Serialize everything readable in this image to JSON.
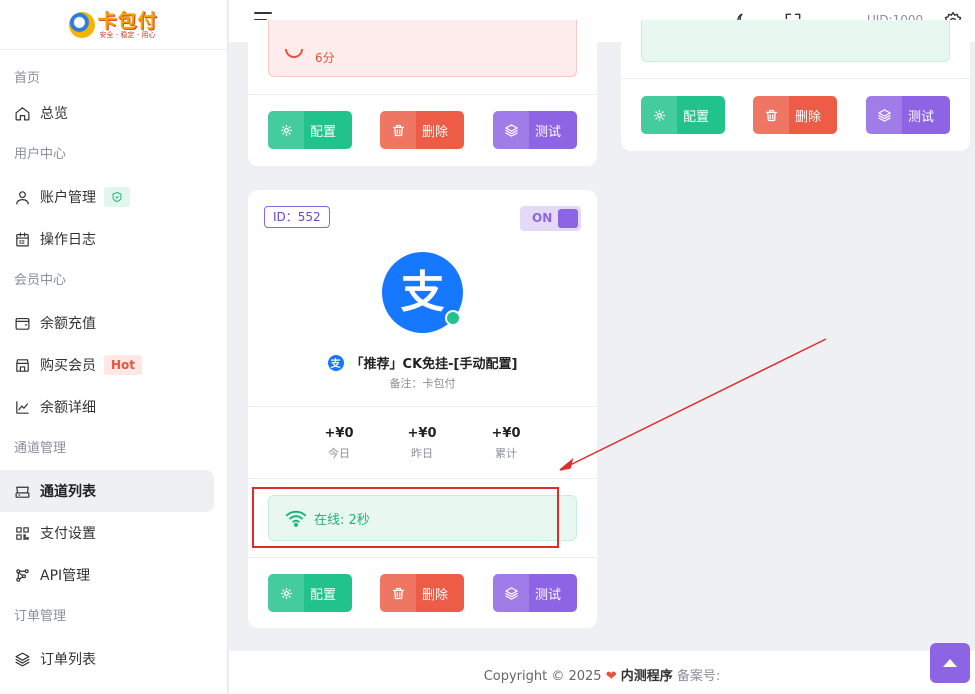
{
  "brand": {
    "logo_title": "卡包付",
    "logo_sub": "安全 - 稳定 - 用心"
  },
  "sidebar": {
    "sections": [
      {
        "title": "首页",
        "items": [
          {
            "label": "总览",
            "icon": "home-icon"
          }
        ]
      },
      {
        "title": "用户中心",
        "items": [
          {
            "label": "账户管理",
            "icon": "user-icon",
            "badge": "shield"
          },
          {
            "label": "操作日志",
            "icon": "calendar-icon"
          }
        ]
      },
      {
        "title": "会员中心",
        "items": [
          {
            "label": "余额充值",
            "icon": "wallet-icon"
          },
          {
            "label": "购买会员",
            "icon": "store-icon",
            "badge": "Hot"
          },
          {
            "label": "余额详细",
            "icon": "chart-line-icon"
          }
        ]
      },
      {
        "title": "通道管理",
        "items": [
          {
            "label": "通道列表",
            "icon": "drive-icon",
            "active": true
          },
          {
            "label": "支付设置",
            "icon": "qrcode-icon"
          },
          {
            "label": "API管理",
            "icon": "network-icon"
          }
        ]
      },
      {
        "title": "订单管理",
        "items": [
          {
            "label": "订单列表",
            "icon": "layers-icon"
          }
        ]
      }
    ],
    "hot_badge": "Hot"
  },
  "topbar": {
    "uid": "UID:1000"
  },
  "cards": {
    "top_left": {
      "alert_text": "6分",
      "buttons": {
        "config": "配置",
        "delete": "删除",
        "test": "测试"
      }
    },
    "top_right": {
      "buttons": {
        "config": "配置",
        "delete": "删除",
        "test": "测试"
      }
    },
    "main": {
      "id_badge": "ID：552",
      "toggle": "ON",
      "logo_char": "支",
      "mini_logo_char": "支",
      "name": "「推荐」CK免挂-[手动配置]",
      "remark": "备注：卡包付",
      "stats": [
        {
          "value": "+¥0",
          "label": "今日"
        },
        {
          "value": "+¥0",
          "label": "昨日"
        },
        {
          "value": "+¥0",
          "label": "累计"
        }
      ],
      "online_status": "在线: 2秒",
      "buttons": {
        "config": "配置",
        "delete": "删除",
        "test": "测试"
      }
    }
  },
  "footer": {
    "prefix": "Copyright © 2025",
    "heart": "❤",
    "brand": "内测程序",
    "beian": "备案号:"
  },
  "colors": {
    "accent_purple": "#8d64e3",
    "green": "#21c28c",
    "red": "#ec5c46",
    "annotation_red": "#e22c2c"
  }
}
